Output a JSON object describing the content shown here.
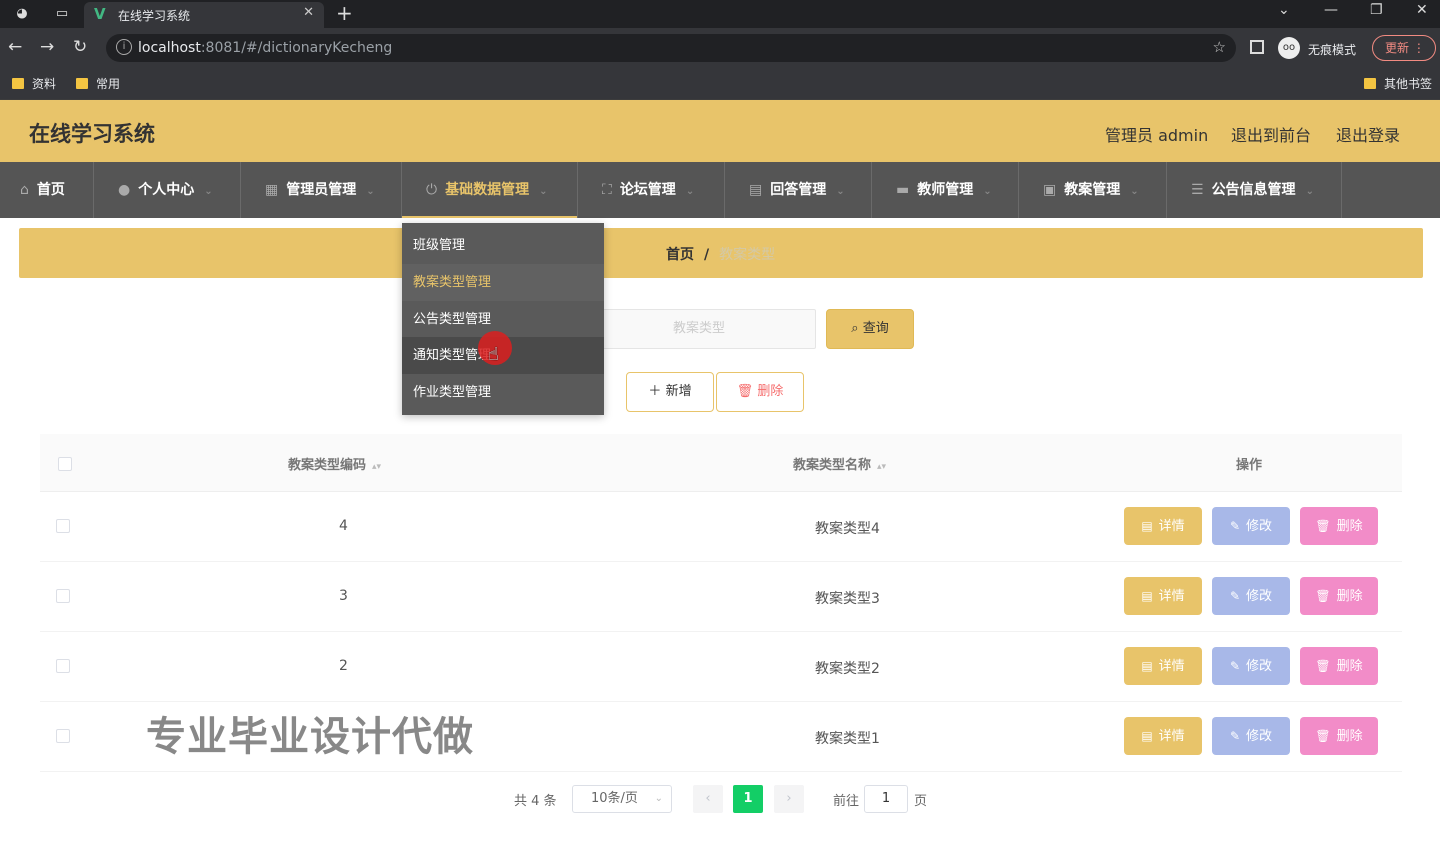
{
  "browser": {
    "tab_title": "在线学习系统",
    "tab_favicon": "V",
    "url_host": "localhost",
    "url_path": ":8081/#/dictionaryKecheng",
    "incognito_label": "无痕模式",
    "update_label": "更新",
    "bookmarks": [
      "资料",
      "常用"
    ],
    "other_bookmarks": "其他书签"
  },
  "header": {
    "title": "在线学习系统",
    "admin_label": "管理员 admin",
    "back_frontend": "退出到前台",
    "logout": "退出登录"
  },
  "nav": {
    "items": [
      {
        "label": "首页",
        "icon": "home-icon"
      },
      {
        "label": "个人中心",
        "icon": "user-icon"
      },
      {
        "label": "管理员管理",
        "icon": "grid-icon"
      },
      {
        "label": "基础数据管理",
        "icon": "power-icon"
      },
      {
        "label": "论坛管理",
        "icon": "fullscreen-icon"
      },
      {
        "label": "回答管理",
        "icon": "list-icon"
      },
      {
        "label": "教师管理",
        "icon": "monitor-icon"
      },
      {
        "label": "教案管理",
        "icon": "box-icon"
      },
      {
        "label": "公告信息管理",
        "icon": "stack-icon"
      }
    ]
  },
  "dropdown": {
    "items": [
      "班级管理",
      "教案类型管理",
      "公告类型管理",
      "通知类型管理",
      "作业类型管理"
    ]
  },
  "breadcrumb": {
    "home": "首页",
    "separator": "/",
    "current": "教案类型"
  },
  "search": {
    "placeholder": "教案类型",
    "query_label": "查询"
  },
  "actions": {
    "add_label": "新增",
    "delete_label": "删除"
  },
  "table": {
    "columns": [
      "教案类型编码",
      "教案类型名称",
      "操作"
    ],
    "rows": [
      {
        "code": "4",
        "name": "教案类型4"
      },
      {
        "code": "3",
        "name": "教案类型3"
      },
      {
        "code": "2",
        "name": "教案类型2"
      },
      {
        "code": "1",
        "name": "教案类型1"
      }
    ],
    "row_actions": {
      "detail": "详情",
      "edit": "修改",
      "remove": "删除"
    }
  },
  "pagination": {
    "total_label": "共 4 条",
    "page_size": "10条/页",
    "current_page": "1",
    "goto_prefix": "前往",
    "goto_value": "1",
    "goto_suffix": "页"
  },
  "watermark": "专业毕业设计代做",
  "colors": {
    "accent": "#e8c46a",
    "nav_bg": "#555555",
    "pager_active": "#13ce66",
    "edit_btn": "#a8b8e8",
    "remove_btn": "#f28cc8"
  }
}
